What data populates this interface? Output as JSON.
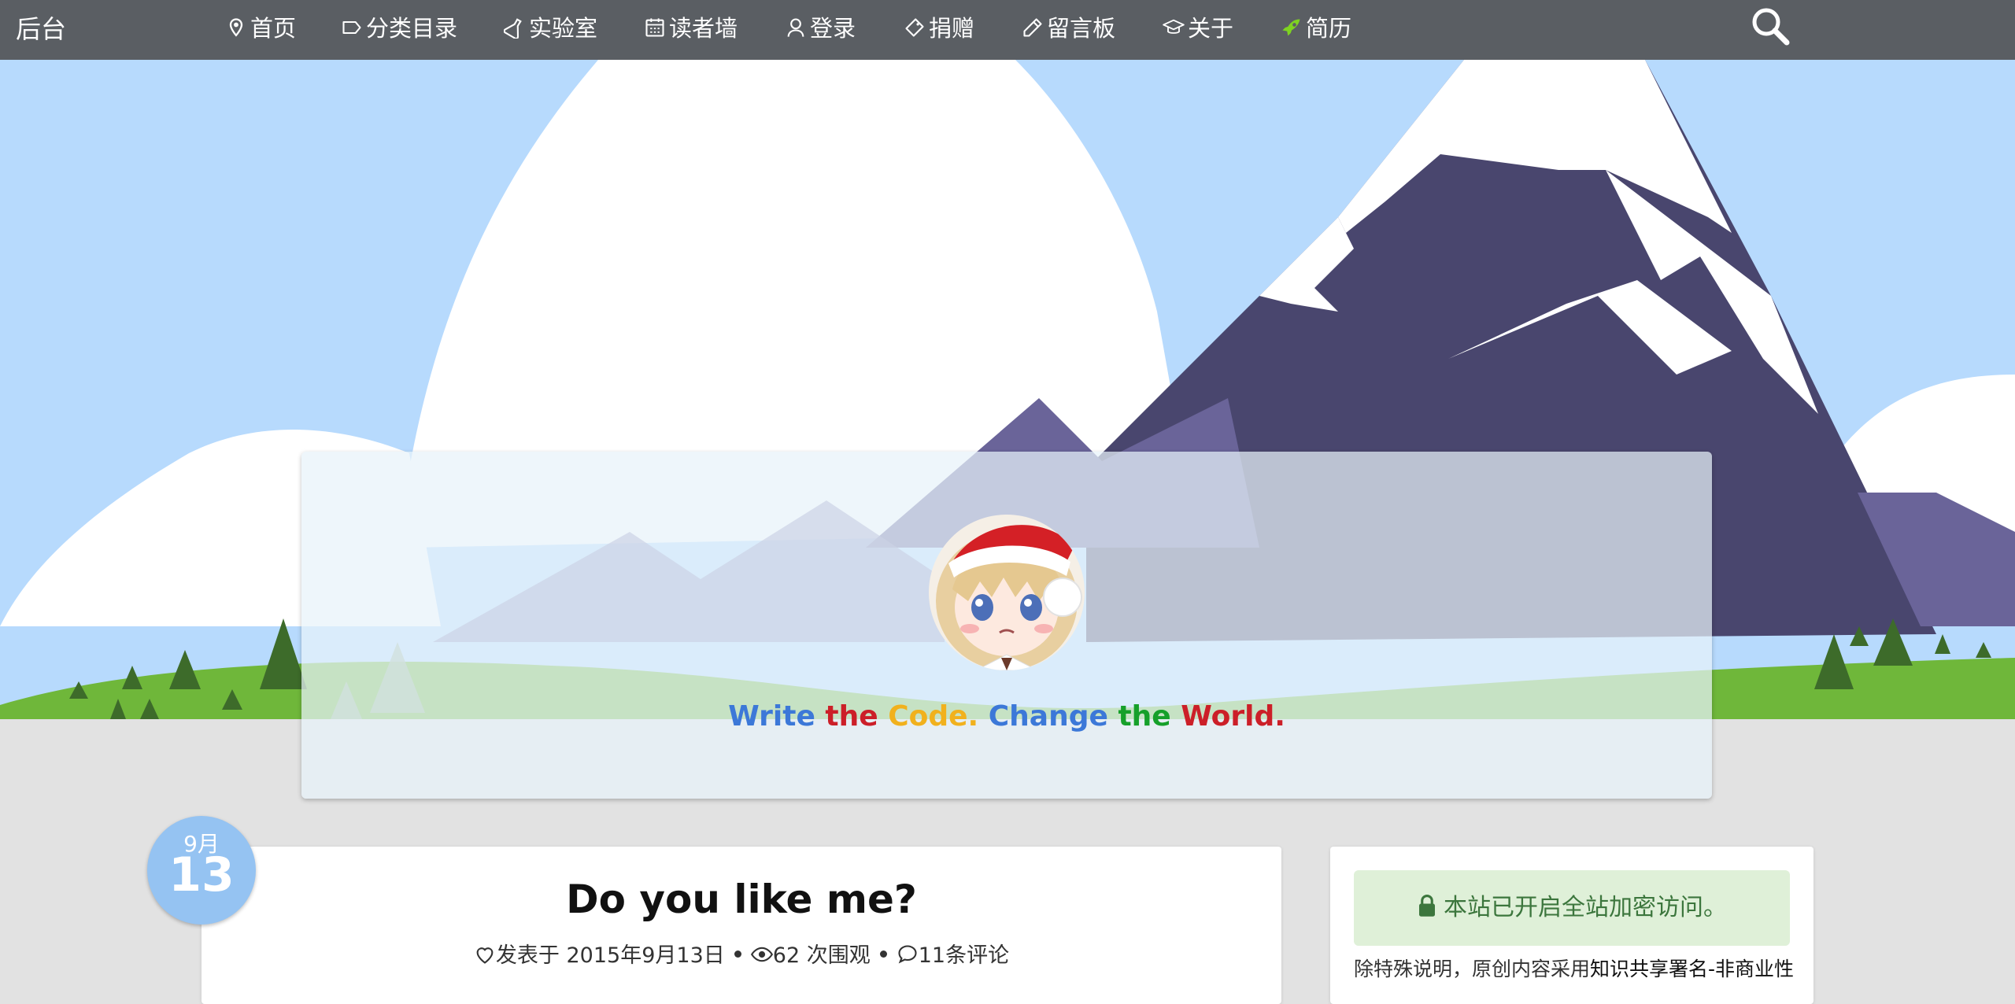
{
  "nav": {
    "brand": "后台",
    "items": [
      {
        "label": "首页",
        "icon": "map-pin-icon"
      },
      {
        "label": "分类目录",
        "icon": "tag-icon"
      },
      {
        "label": "实验室",
        "icon": "flask-icon"
      },
      {
        "label": "读者墙",
        "icon": "calendar-icon"
      },
      {
        "label": "登录",
        "icon": "user-icon"
      },
      {
        "label": "捐赠",
        "icon": "ticket-icon"
      },
      {
        "label": "留言板",
        "icon": "pencil-icon"
      },
      {
        "label": "关于",
        "icon": "graduation-cap-icon"
      },
      {
        "label": "简历",
        "icon": "rocket-icon"
      }
    ],
    "search_icon": "search-icon"
  },
  "hero": {
    "colors": {
      "sky": "#b7dafd",
      "mountain": "#49466e",
      "mountain_light": "#6a6499",
      "snow": "#ffffff",
      "grass": "#6fb73a",
      "tree": "#3d6b2a"
    }
  },
  "profile": {
    "avatar_alt": "avatar",
    "slogan": [
      {
        "text": "Write ",
        "color": "#3c78d8"
      },
      {
        "text": "the ",
        "color": "#cc1f28"
      },
      {
        "text": "Code. ",
        "color": "#f1b11d"
      },
      {
        "text": "Change ",
        "color": "#3c78d8"
      },
      {
        "text": "the ",
        "color": "#16a02a"
      },
      {
        "text": "World.",
        "color": "#cc1f28"
      }
    ]
  },
  "post": {
    "date_month": "9月",
    "date_day": "13",
    "title": "Do you like me?",
    "meta": {
      "posted": "发表于 2015年9月13日",
      "views": "62 次围观",
      "comments": "11条评论"
    }
  },
  "sidebar": {
    "alert": "本站已开启全站加密访问。",
    "license_prefix": "除特殊说明，原创内容采用",
    "license_link": "知识共享署名-非商业性"
  }
}
